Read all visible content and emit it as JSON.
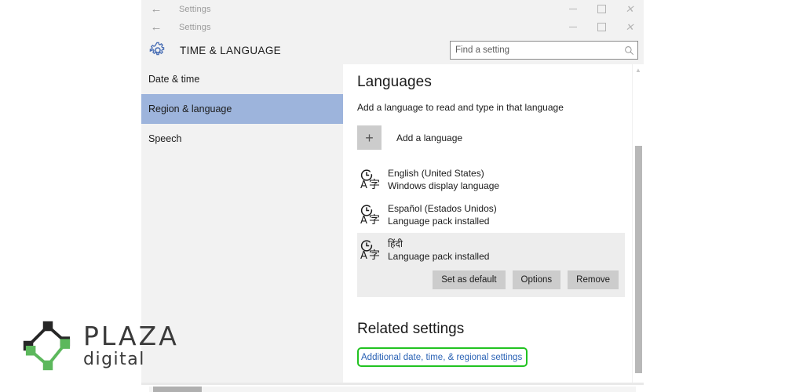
{
  "window": {
    "title_bars": [
      {
        "back_icon": "back-arrow-icon",
        "title": "Settings"
      },
      {
        "back_icon": "back-arrow-icon",
        "title": "Settings"
      }
    ],
    "controls": {
      "minimize": "—",
      "maximize": "□",
      "close": "✕"
    }
  },
  "header": {
    "gear_icon": "gear-icon",
    "title": "TIME & LANGUAGE"
  },
  "search": {
    "placeholder": "Find a setting",
    "value": "",
    "icon": "search-icon"
  },
  "sidebar": {
    "items": [
      {
        "label": "Date & time",
        "selected": false
      },
      {
        "label": "Region & language",
        "selected": true
      },
      {
        "label": "Speech",
        "selected": false
      }
    ]
  },
  "main": {
    "languages": {
      "title": "Languages",
      "description": "Add a language to read and type in that language",
      "add_language": {
        "icon": "plus-icon",
        "label": "Add a language"
      },
      "items": [
        {
          "icon": "language-icon",
          "name": "English (United States)",
          "status": "Windows display language",
          "selected": false
        },
        {
          "icon": "language-icon",
          "name": "Español (Estados Unidos)",
          "status": "Language pack installed",
          "selected": false
        },
        {
          "icon": "language-icon",
          "name": "हिंदी",
          "status": "Language pack installed",
          "selected": true
        }
      ],
      "actions": [
        {
          "label": "Set as default"
        },
        {
          "label": "Options"
        },
        {
          "label": "Remove"
        }
      ]
    },
    "related_settings": {
      "title": "Related settings",
      "link": "Additional date, time, & regional settings",
      "highlighted": true
    }
  },
  "watermark": {
    "wordmark": "PLAZA",
    "subtext": "digital",
    "mark_icon": "plaza-node-diamond-icon"
  },
  "colors": {
    "selection_blue": "#9db4dc",
    "link_blue": "#2a62b5",
    "highlight_green": "#22c321",
    "logo_green": "#5cb85c",
    "logo_dark": "#262626",
    "sidebar_bg": "#f2f2f2",
    "button_gray": "#cccccc"
  }
}
